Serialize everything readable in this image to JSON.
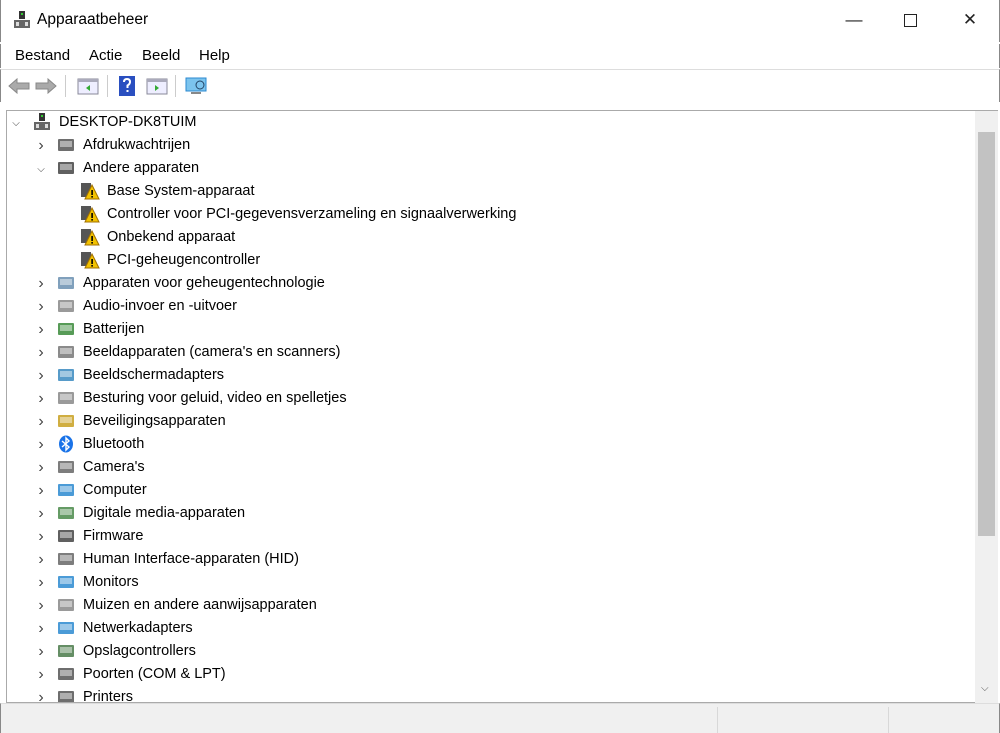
{
  "window": {
    "title": "Apparaatbeheer"
  },
  "menu": [
    {
      "label": "Bestand",
      "key": "B"
    },
    {
      "label": "Actie",
      "key": "A"
    },
    {
      "label": "Beeld",
      "key": "e"
    },
    {
      "label": "Help",
      "key": "H"
    }
  ],
  "tree": {
    "root": "DESKTOP-DK8TUIM",
    "items": [
      {
        "label": "Afdrukwachtrijen",
        "icon": "printer-queue-icon",
        "color": "#555"
      },
      {
        "label": "Andere apparaten",
        "icon": "unknown-device-icon",
        "color": "#444",
        "expanded": true,
        "children": [
          "Base System-apparaat",
          "Controller voor PCI-gegevensverzameling en signaalverwerking",
          "Onbekend apparaat",
          "PCI-geheugencontroller"
        ]
      },
      {
        "label": "Apparaten voor geheugentechnologie",
        "icon": "memory-device-icon",
        "color": "#6a8fb0"
      },
      {
        "label": "Audio-invoer en -uitvoer",
        "icon": "speaker-icon",
        "color": "#888"
      },
      {
        "label": "Batterijen",
        "icon": "battery-icon",
        "color": "#3a8a3a"
      },
      {
        "label": "Beeldapparaten (camera's en scanners)",
        "icon": "scanner-icon",
        "color": "#777"
      },
      {
        "label": "Beeldschermadapters",
        "icon": "display-adapter-icon",
        "color": "#3a8ac0"
      },
      {
        "label": "Besturing voor geluid, video en spelletjes",
        "icon": "sound-icon",
        "color": "#888"
      },
      {
        "label": "Beveiligingsapparaten",
        "icon": "security-key-icon",
        "color": "#c8a020"
      },
      {
        "label": "Bluetooth",
        "icon": "bluetooth-icon",
        "color": "#1a73e8"
      },
      {
        "label": "Camera's",
        "icon": "webcam-icon",
        "color": "#666"
      },
      {
        "label": "Computer",
        "icon": "computer-icon",
        "color": "#2b8ad0"
      },
      {
        "label": "Digitale media-apparaten",
        "icon": "media-device-icon",
        "color": "#4a8a4a"
      },
      {
        "label": "Firmware",
        "icon": "firmware-icon",
        "color": "#444"
      },
      {
        "label": "Human Interface-apparaten (HID)",
        "icon": "hid-icon",
        "color": "#666"
      },
      {
        "label": "Monitors",
        "icon": "monitor-icon",
        "color": "#2b8ad0"
      },
      {
        "label": "Muizen en andere aanwijsapparaten",
        "icon": "mouse-icon",
        "color": "#888"
      },
      {
        "label": "Netwerkadapters",
        "icon": "network-adapter-icon",
        "color": "#2b8ad0"
      },
      {
        "label": "Opslagcontrollers",
        "icon": "storage-controller-icon",
        "color": "#4a7a4a"
      },
      {
        "label": "Poorten (COM & LPT)",
        "icon": "port-icon",
        "color": "#555"
      },
      {
        "label": "Printers",
        "icon": "printer-icon",
        "color": "#555"
      }
    ]
  }
}
